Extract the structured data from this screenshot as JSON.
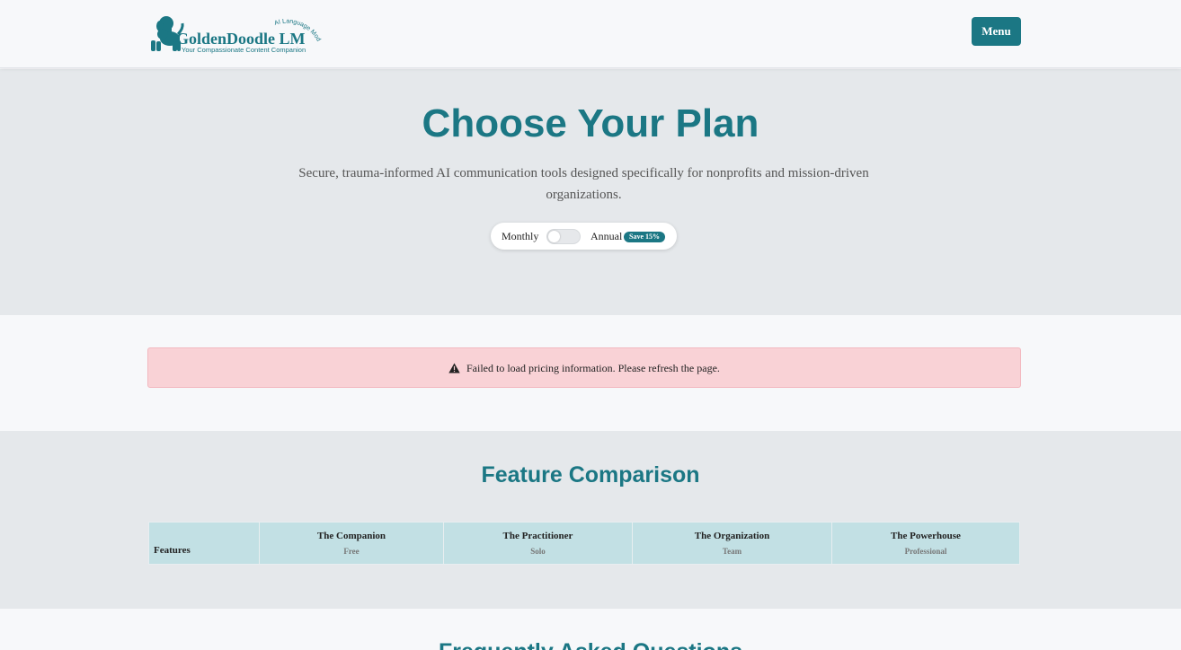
{
  "header": {
    "logo": {
      "name": "GoldenDoodle LM",
      "arc_text": "AI Language Model",
      "tagline": "Your Compassionate Content Companion",
      "icon": "dog-icon"
    },
    "menu_label": "Menu"
  },
  "hero": {
    "title": "Choose Your Plan",
    "subtitle": "Secure, trauma-informed AI communication tools designed specifically for nonprofits and mission-driven organizations.",
    "billing": {
      "monthly_label": "Monthly",
      "annual_label": "Annual",
      "save_badge": "Save 15%",
      "annual_selected": false
    }
  },
  "alert": {
    "icon": "warning-icon",
    "message": "Failed to load pricing information. Please refresh the page."
  },
  "comparison": {
    "title": "Feature Comparison",
    "features_header": "Features",
    "plans": [
      {
        "name": "The Companion",
        "tier": "Free"
      },
      {
        "name": "The Practitioner",
        "tier": "Solo"
      },
      {
        "name": "The Organization",
        "tier": "Team"
      },
      {
        "name": "The Powerhouse",
        "tier": "Professional"
      }
    ]
  },
  "faq": {
    "title": "Frequently Asked Questions"
  },
  "colors": {
    "brand": "#1b7784",
    "hero_bg": "#e5e8eb",
    "alert_bg": "#f9d2d6",
    "table_header_bg": "#c2e0e4"
  }
}
